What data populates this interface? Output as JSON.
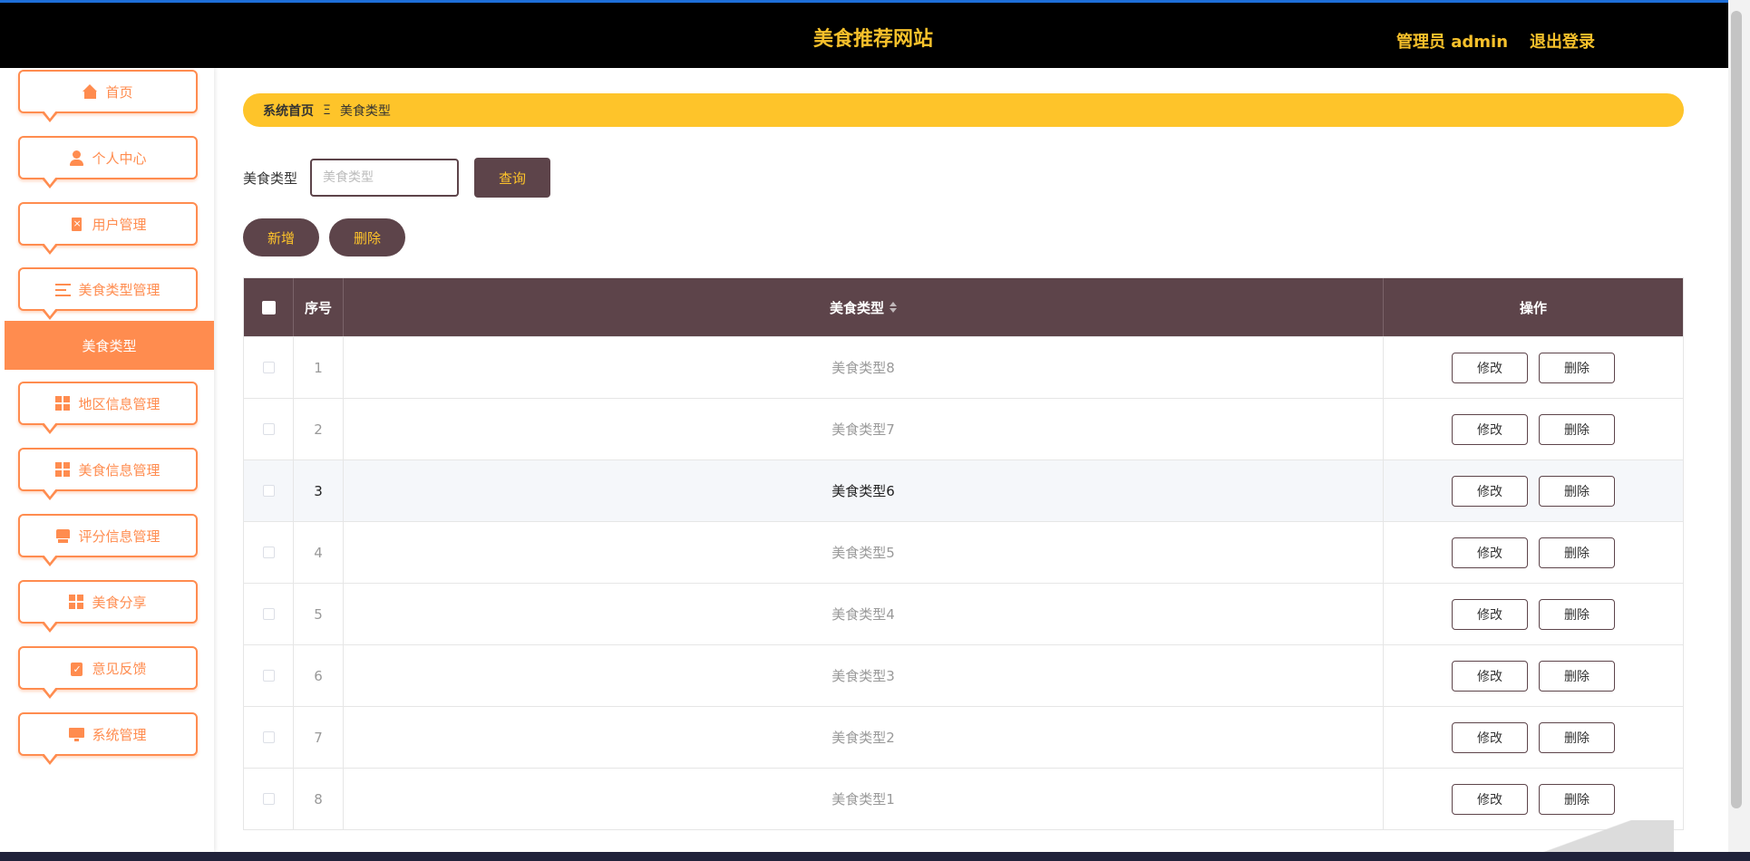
{
  "header": {
    "title": "美食推荐网站",
    "admin_label": "管理员 admin",
    "logout_label": "退出登录"
  },
  "sidebar": {
    "items": [
      {
        "label": "首页",
        "icon": "home-icon"
      },
      {
        "label": "个人中心",
        "icon": "user-icon"
      },
      {
        "label": "用户管理",
        "icon": "document-icon"
      },
      {
        "label": "美食类型管理",
        "icon": "list-icon"
      },
      {
        "label": "地区信息管理",
        "icon": "grid-icon"
      },
      {
        "label": "美食信息管理",
        "icon": "grid-icon"
      },
      {
        "label": "评分信息管理",
        "icon": "box-icon"
      },
      {
        "label": "美食分享",
        "icon": "grid-icon"
      },
      {
        "label": "意见反馈",
        "icon": "clipboard-icon"
      },
      {
        "label": "系统管理",
        "icon": "monitor-icon"
      }
    ],
    "active_sub_item": "美食类型"
  },
  "breadcrumb": {
    "home": "系统首页",
    "separator": "Ξ",
    "current": "美食类型"
  },
  "search": {
    "label": "美食类型",
    "placeholder": "美食类型",
    "value": "",
    "query_button": "查询"
  },
  "actions": {
    "add_button": "新增",
    "delete_button": "删除"
  },
  "table": {
    "headers": {
      "index": "序号",
      "type": "美食类型",
      "operation": "操作"
    },
    "edit_label": "修改",
    "delete_label": "删除",
    "rows": [
      {
        "index": "1",
        "type": "美食类型8"
      },
      {
        "index": "2",
        "type": "美食类型7"
      },
      {
        "index": "3",
        "type": "美食类型6"
      },
      {
        "index": "4",
        "type": "美食类型5"
      },
      {
        "index": "5",
        "type": "美食类型4"
      },
      {
        "index": "6",
        "type": "美食类型3"
      },
      {
        "index": "7",
        "type": "美食类型2"
      },
      {
        "index": "8",
        "type": "美食类型1"
      }
    ]
  },
  "colors": {
    "header_bg": "#000000",
    "accent_yellow": "#fec42a",
    "accent_orange": "#ff8c4f",
    "brown": "#5d444a"
  }
}
